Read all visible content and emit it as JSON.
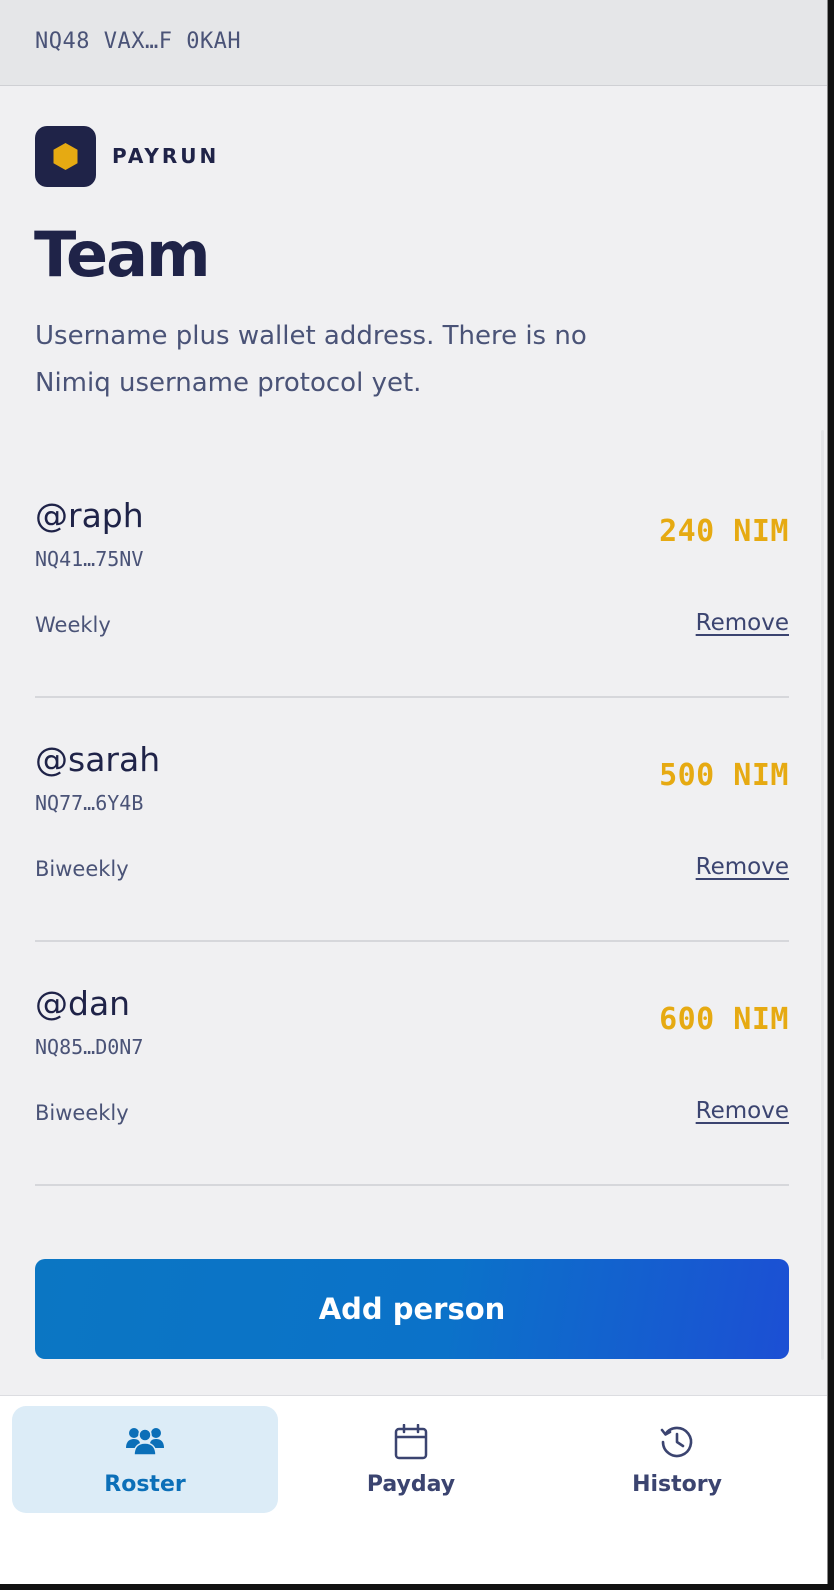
{
  "header": {
    "wallet_address": "NQ48 VAX…F 0KAH"
  },
  "brand": {
    "name": "PAYRUN",
    "logo_icon": "hexagon-icon",
    "accent": "#e6aa12"
  },
  "page": {
    "title": "Team",
    "description": "Username plus wallet address. There is no Nimiq username protocol yet."
  },
  "members": [
    {
      "username": "@raph",
      "wallet": "NQ41…75NV",
      "amount": "240 NIM",
      "frequency": "Weekly",
      "remove_label": "Remove"
    },
    {
      "username": "@sarah",
      "wallet": "NQ77…6Y4B",
      "amount": "500 NIM",
      "frequency": "Biweekly",
      "remove_label": "Remove"
    },
    {
      "username": "@dan",
      "wallet": "NQ85…D0N7",
      "amount": "600 NIM",
      "frequency": "Biweekly",
      "remove_label": "Remove"
    }
  ],
  "actions": {
    "add_person_label": "Add person"
  },
  "tabs": [
    {
      "label": "Roster",
      "icon": "users-icon",
      "active": true
    },
    {
      "label": "Payday",
      "icon": "calendar-icon",
      "active": false
    },
    {
      "label": "History",
      "icon": "history-icon",
      "active": false
    }
  ],
  "colors": {
    "primary": "#0b72c9",
    "text_dark": "#1f2348",
    "amount": "#e6aa12"
  }
}
